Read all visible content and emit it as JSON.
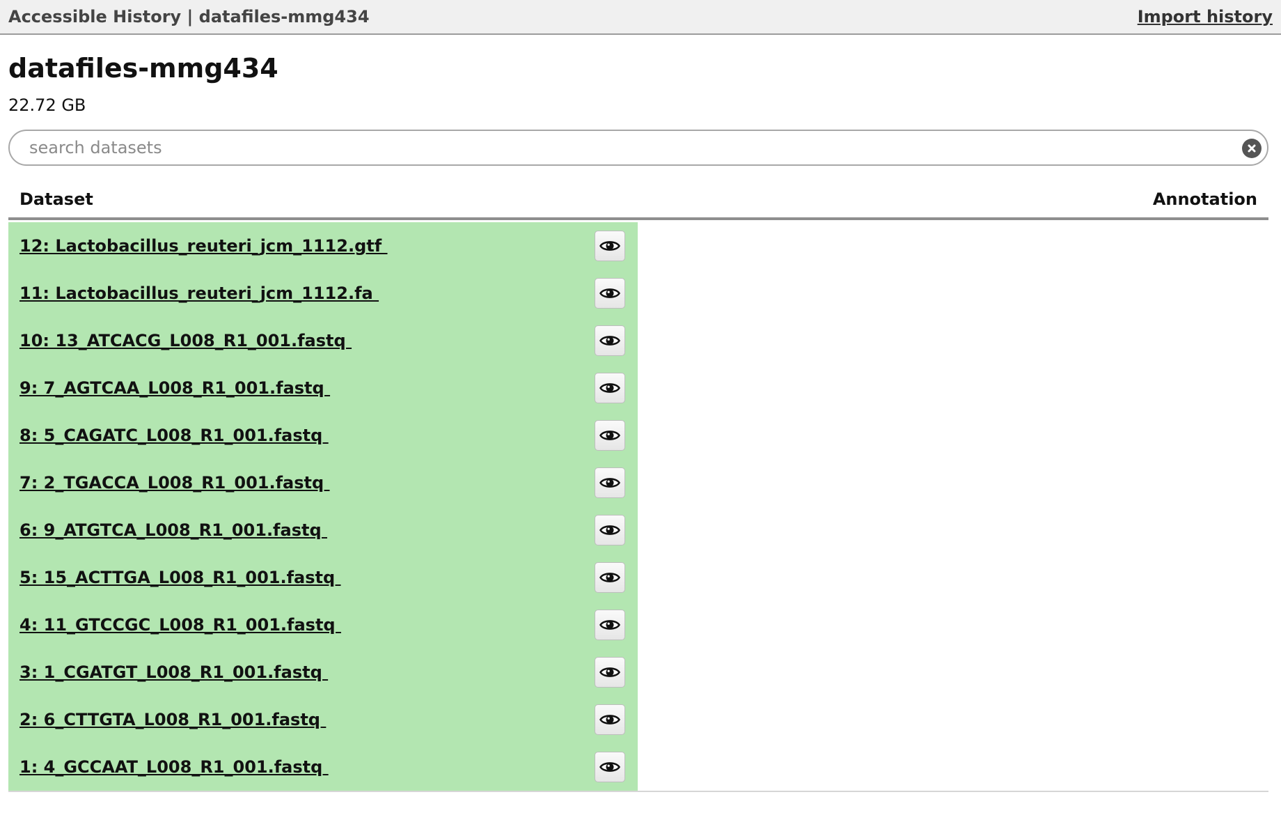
{
  "topbar": {
    "title": "Accessible History | datafiles-mmg434",
    "import_label": "Import history"
  },
  "history": {
    "name": "datafiles-mmg434",
    "size": "22.72 GB"
  },
  "search": {
    "placeholder": "search datasets",
    "value": ""
  },
  "table": {
    "headers": {
      "dataset": "Dataset",
      "annotation": "Annotation"
    },
    "rows": [
      {
        "label": "12: Lactobacillus_reuteri_jcm_1112.gtf ",
        "annotation": ""
      },
      {
        "label": "11: Lactobacillus_reuteri_jcm_1112.fa ",
        "annotation": ""
      },
      {
        "label": "10: 13_ATCACG_L008_R1_001.fastq ",
        "annotation": ""
      },
      {
        "label": "9: 7_AGTCAA_L008_R1_001.fastq ",
        "annotation": ""
      },
      {
        "label": "8: 5_CAGATC_L008_R1_001.fastq ",
        "annotation": ""
      },
      {
        "label": "7: 2_TGACCA_L008_R1_001.fastq ",
        "annotation": ""
      },
      {
        "label": "6: 9_ATGTCA_L008_R1_001.fastq ",
        "annotation": ""
      },
      {
        "label": "5: 15_ACTTGA_L008_R1_001.fastq ",
        "annotation": ""
      },
      {
        "label": "4: 11_GTCCGC_L008_R1_001.fastq ",
        "annotation": ""
      },
      {
        "label": "3: 1_CGATGT_L008_R1_001.fastq ",
        "annotation": ""
      },
      {
        "label": "2: 6_CTTGTA_L008_R1_001.fastq ",
        "annotation": ""
      },
      {
        "label": "1: 4_GCCAAT_L008_R1_001.fastq ",
        "annotation": ""
      }
    ]
  },
  "icons": {
    "view": "eye-icon",
    "clear": "clear-search-icon"
  },
  "colors": {
    "row_ok": "#b3e6b1",
    "topbar_bg": "#f0f0f0"
  }
}
